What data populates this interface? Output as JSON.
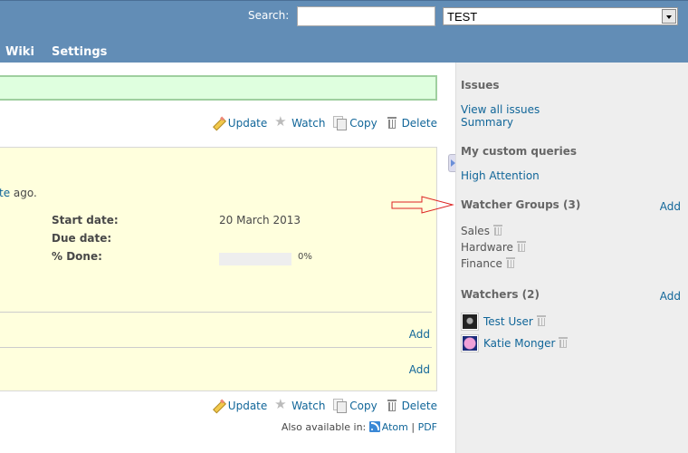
{
  "header": {
    "search_label": "Search:",
    "search_value": "",
    "project_select_value": "TEST",
    "menu": [
      {
        "label": "Wiki"
      },
      {
        "label": "Settings"
      }
    ]
  },
  "actions": {
    "update": "Update",
    "watch": "Watch",
    "copy": "Copy",
    "delete": "Delete"
  },
  "issue": {
    "author_link_fragment": "te",
    "author_suffix": " ago.",
    "attributes": [
      {
        "label": "Start date:",
        "value": "20 March 2013"
      },
      {
        "label": "Due date:",
        "value": ""
      },
      {
        "label": "% Done:",
        "value": ""
      }
    ],
    "done_ratio_percent": 0,
    "done_ratio_text": "0%",
    "section_add_1": "Add",
    "section_add_2": "Add"
  },
  "other_formats": {
    "label": "Also available in:",
    "atom": "Atom",
    "separator": "|",
    "pdf": "PDF"
  },
  "sidebar": {
    "issues_heading": "Issues",
    "view_all_issues": "View all issues",
    "summary": "Summary",
    "custom_queries_heading": "My custom queries",
    "custom_queries": [
      "High Attention"
    ],
    "watcher_groups_heading": "Watcher Groups (3)",
    "watcher_groups_add": "Add",
    "watcher_groups": [
      "Sales",
      "Hardware",
      "Finance"
    ],
    "watchers_heading": "Watchers (2)",
    "watchers_add": "Add",
    "watchers": [
      "Test User",
      "Katie Monger"
    ]
  },
  "colors": {
    "header_bg": "#628db6",
    "link": "#116699",
    "flash_bg": "#dfffdf",
    "issue_bg": "#ffffdd",
    "sidebar_bg": "#eeeeee",
    "annotation_arrow": "#dd2222"
  }
}
